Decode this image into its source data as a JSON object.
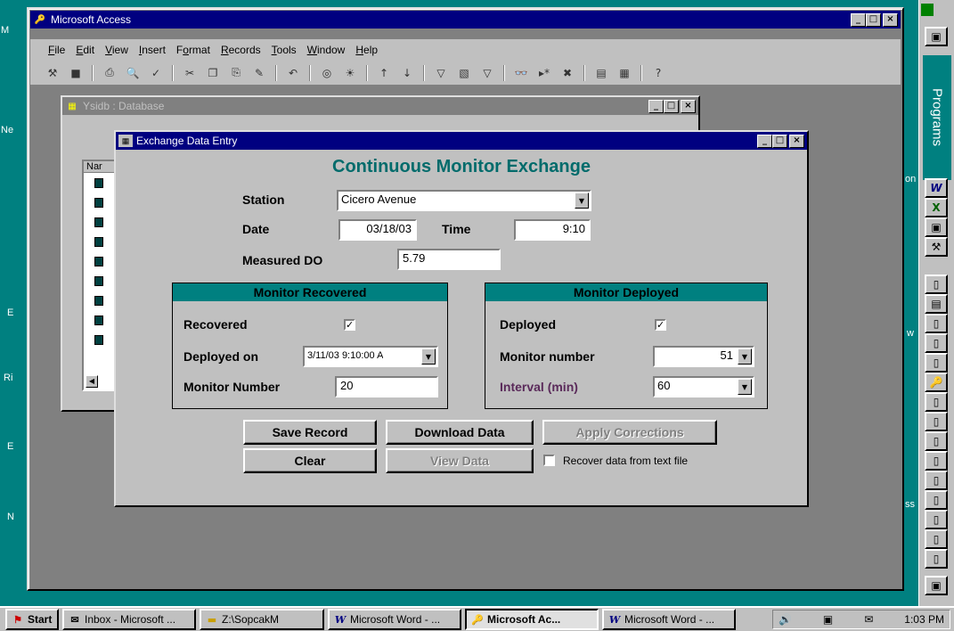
{
  "app": {
    "title": "Microsoft Access"
  },
  "menu": [
    {
      "label": "File",
      "hotkey": "F",
      "rest": "ile"
    },
    {
      "label": "Edit",
      "hotkey": "E",
      "rest": "dit"
    },
    {
      "label": "View",
      "hotkey": "V",
      "rest": "iew"
    },
    {
      "label": "Insert",
      "hotkey": "I",
      "rest": "nsert"
    },
    {
      "label": "Format",
      "hotkey": "o",
      "pre": "F",
      "rest": "rmat"
    },
    {
      "label": "Records",
      "hotkey": "R",
      "rest": "ecords"
    },
    {
      "label": "Tools",
      "hotkey": "T",
      "rest": "ools"
    },
    {
      "label": "Window",
      "hotkey": "W",
      "rest": "indow"
    },
    {
      "label": "Help",
      "hotkey": "H",
      "rest": "elp"
    }
  ],
  "db_window": {
    "title": "Ysidb : Database",
    "list_header": "Nar"
  },
  "form": {
    "window_title": "Exchange Data Entry",
    "heading": "Continuous Monitor Exchange",
    "station_label": "Station",
    "station_value": "Cicero Avenue",
    "date_label": "Date",
    "date_value": "03/18/03",
    "time_label": "Time",
    "time_value": "9:10",
    "measured_do_label": "Measured DO",
    "measured_do_value": "5.79",
    "recovered_panel": {
      "header": "Monitor Recovered",
      "recovered_label": "Recovered",
      "recovered_checked": true,
      "deployed_on_label": "Deployed on",
      "deployed_on_value": "3/11/03 9:10:00 A",
      "monitor_number_label": "Monitor Number",
      "monitor_number_value": "20"
    },
    "deployed_panel": {
      "header": "Monitor Deployed",
      "deployed_label": "Deployed",
      "deployed_checked": true,
      "monitor_number_label": "Monitor number",
      "monitor_number_value": "51",
      "interval_label": "Interval (min)",
      "interval_value": "60",
      "interval_color": "#5a2a5a"
    },
    "buttons": {
      "save": "Save Record",
      "download": "Download Data",
      "apply": "Apply Corrections",
      "clear": "Clear",
      "view": "View Data"
    },
    "recover_text_label": "Recover data from text file",
    "recover_text_checked": false
  },
  "taskbar": {
    "start": "Start",
    "items": [
      "Inbox - Microsoft ...",
      "Z:\\SopcakM",
      "Microsoft Word - ...",
      "Microsoft Ac...",
      "Microsoft Word - ..."
    ],
    "clock": "1:03 PM"
  },
  "officebar": {
    "programs_label": "Programs"
  },
  "desktop_fragments": [
    "M",
    "Ne",
    "E",
    "Ri",
    "E",
    "N",
    "on",
    "w",
    "ss"
  ],
  "colors": {
    "title_active": "#000080",
    "desktop": "#008080",
    "panel_header": "#008080"
  }
}
